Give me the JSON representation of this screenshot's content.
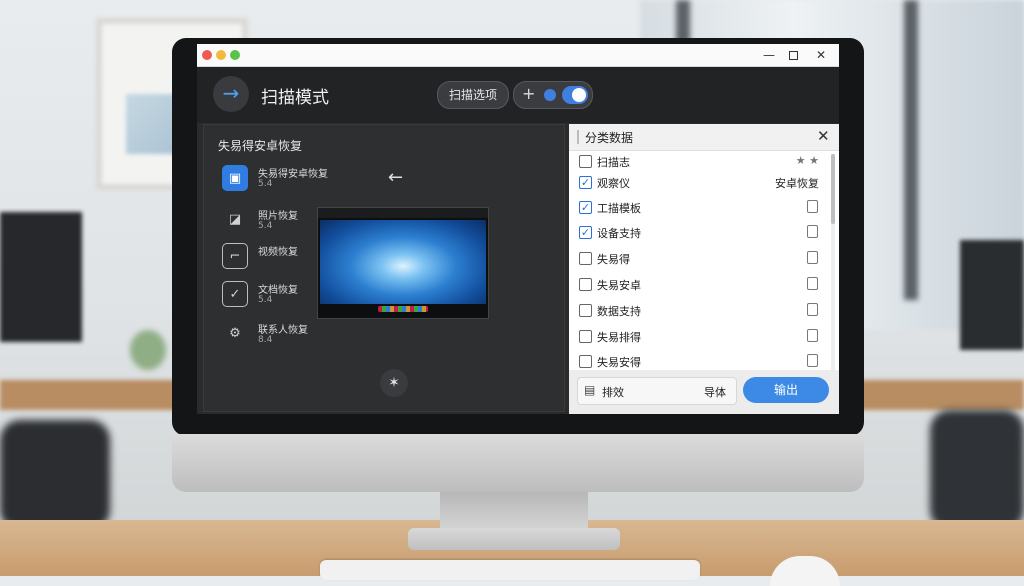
{
  "app": {
    "title": "扫描模式",
    "scan_button": "扫描选项",
    "toggle_plus": "+",
    "back_icon": "arrow-right-icon"
  },
  "window_controls": {
    "minimize": "—",
    "close": "✕"
  },
  "left_panel": {
    "title": "失易得安卓恢复",
    "items": [
      {
        "line1": "失易得安卓恢复",
        "line2": "5.4",
        "icon": "briefcase-icon",
        "active": true
      },
      {
        "line1": "照片恢复",
        "line2": "5.4",
        "icon": "image-icon"
      },
      {
        "line1": "视频恢复",
        "line2": "",
        "icon": "copy-icon"
      },
      {
        "line1": "文档恢复",
        "line2": "5.4",
        "icon": "checkbox-icon"
      },
      {
        "line1": "联系人恢复",
        "line2": "8.4",
        "icon": "gear-icon"
      }
    ],
    "arrow": "←",
    "sparkle": "✶"
  },
  "right_panel": {
    "title": "分类数据",
    "close": "✕",
    "rows": [
      {
        "label": "扫描志",
        "checked": false,
        "tag": "★ ★"
      },
      {
        "label": "观察仪",
        "checked": true,
        "tag": "安卓恢复"
      },
      {
        "label": "工描模板",
        "checked": true,
        "tag": ""
      },
      {
        "label": "设备支持",
        "checked": true,
        "tag": ""
      },
      {
        "label": "失易得",
        "checked": false,
        "tag": ""
      },
      {
        "label": "失易安卓",
        "checked": false,
        "tag": ""
      },
      {
        "label": "数据支持",
        "checked": false,
        "tag": ""
      },
      {
        "label": "失易排得",
        "checked": false,
        "tag": ""
      },
      {
        "label": "失易安得",
        "checked": false,
        "tag": ""
      }
    ],
    "footer": {
      "left": "排效",
      "right": "导体",
      "button": "输出"
    }
  },
  "colors": {
    "accent": "#3c8ae6",
    "dark": "#2b2b2c"
  }
}
